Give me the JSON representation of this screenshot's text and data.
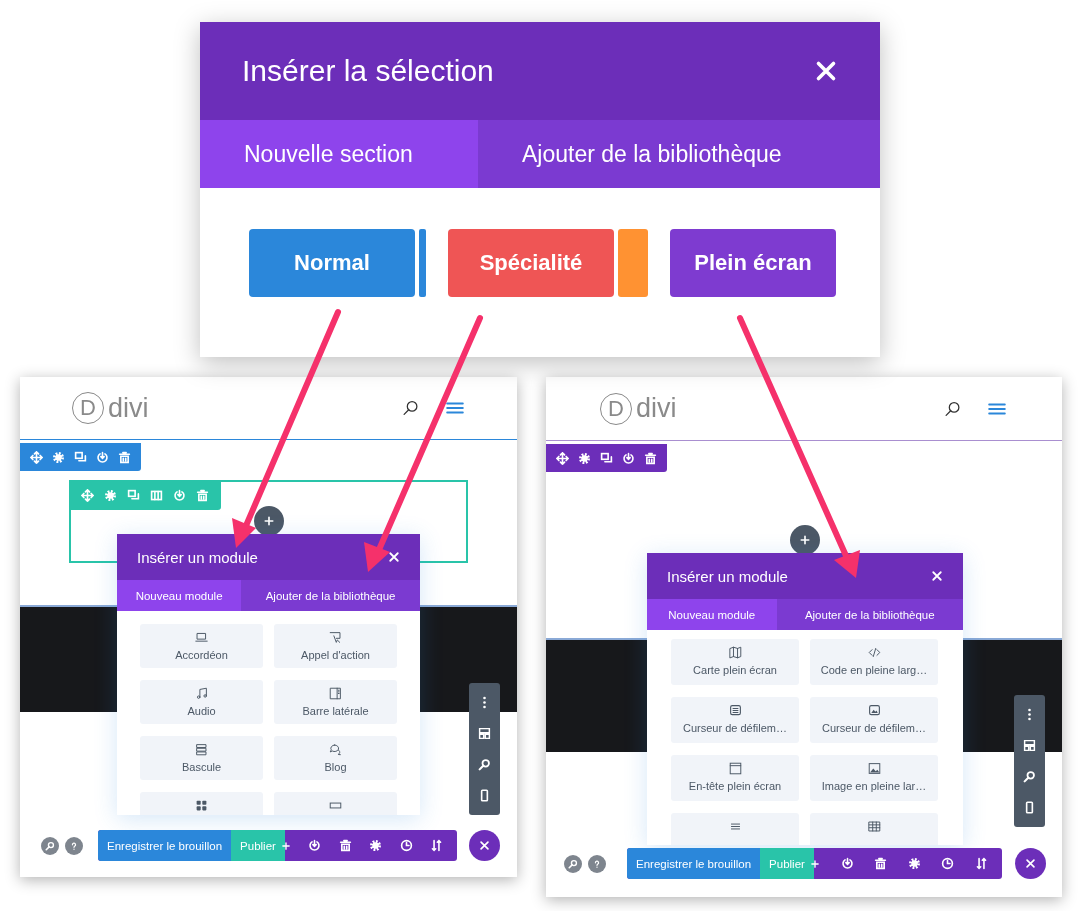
{
  "insert_dialog": {
    "title": "Insérer la sélection",
    "tabs": [
      {
        "label": "Nouvelle section",
        "selected": true
      },
      {
        "label": "Ajouter de la bibliothèque",
        "selected": false
      }
    ],
    "buttons": [
      {
        "label": "Normal",
        "kind": "regular"
      },
      {
        "label": "Spécialité",
        "kind": "specialty"
      },
      {
        "label": "Plein écran",
        "kind": "fullwidth"
      }
    ]
  },
  "builders": [
    {
      "logo": {
        "letter": "D",
        "text": "divi"
      },
      "section": {
        "kind": "regular"
      },
      "row": true,
      "modal": {
        "title": "Insérer un module",
        "tabs": [
          {
            "label": "Nouveau module",
            "selected": true
          },
          {
            "label": "Ajouter de la bibliothèque",
            "selected": false
          }
        ],
        "modules": [
          {
            "kind": "laptop",
            "label": "Accordéon"
          },
          {
            "kind": "cursor",
            "label": "Appel d'action"
          },
          {
            "kind": "music",
            "label": "Audio"
          },
          {
            "kind": "sidebar",
            "label": "Barre latérale"
          },
          {
            "kind": "stack",
            "label": "Bascule"
          },
          {
            "kind": "chat",
            "label": "Blog"
          },
          {
            "kind": "grid"
          },
          {
            "kind": "bar"
          }
        ]
      },
      "save_label": "Enregistrer le brouillon",
      "publish_label": "Publier"
    },
    {
      "logo": {
        "letter": "D",
        "text": "divi"
      },
      "section": {
        "kind": "fullwidth"
      },
      "row": false,
      "modal": {
        "title": "Insérer un module",
        "tabs": [
          {
            "label": "Nouveau module",
            "selected": true
          },
          {
            "label": "Ajouter de la bibliothèque",
            "selected": false
          }
        ],
        "modules": [
          {
            "kind": "map",
            "label": "Carte plein écran"
          },
          {
            "kind": "code",
            "label": "Code en pleine larg…"
          },
          {
            "kind": "slide",
            "label": "Curseur de défilem…"
          },
          {
            "kind": "image-slide",
            "label": "Curseur de défilem…"
          },
          {
            "kind": "window",
            "label": "En-tête plein écran"
          },
          {
            "kind": "image",
            "label": "Image en pleine lar…"
          },
          {
            "kind": "lines"
          },
          {
            "kind": "table"
          }
        ]
      },
      "save_label": "Enregistrer le brouillon",
      "publish_label": "Publier"
    }
  ]
}
